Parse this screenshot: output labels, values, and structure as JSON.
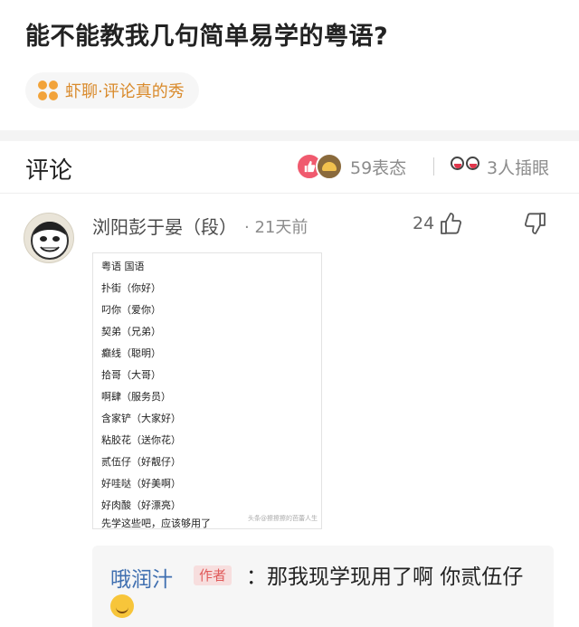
{
  "question": {
    "title": "能不能教我几句简单易学的粤语?"
  },
  "topic_tag": {
    "label": "虾聊·评论真的秀",
    "icon": "flower-icon",
    "color": "#f2a33a"
  },
  "comments_header": {
    "title": "评论",
    "reactions_count": "59表态",
    "insert_eye_count": "3人插眼"
  },
  "comment": {
    "username": "浏阳彭于晏（段）",
    "timestamp": "· 21天前",
    "like_count": "24",
    "image_lines": [
      "粤语  国语",
      "扑街（你好）",
      "叼你（爱你）",
      "契弟（兄弟）",
      "癫线（聪明）",
      "拾哥（大哥）",
      "啊肆（服务员）",
      "含家铲（大家好）",
      "粘胶花（送你花）",
      "贰伍仔（好靓仔）",
      "好哇哒（好美啊）",
      "好肉酸（好漂亮）",
      "先学这些吧，应该够用了"
    ],
    "image_watermark": "头条@擦擦擦的芭蕾人生"
  },
  "reply": {
    "author": "哦润汁",
    "badge": "作者",
    "text": "：那我现学现用了啊 你贰伍仔"
  },
  "colors": {
    "accent_red": "#f05a6e",
    "link_blue": "#3f6fb0",
    "tag_orange": "#d98a2b"
  }
}
